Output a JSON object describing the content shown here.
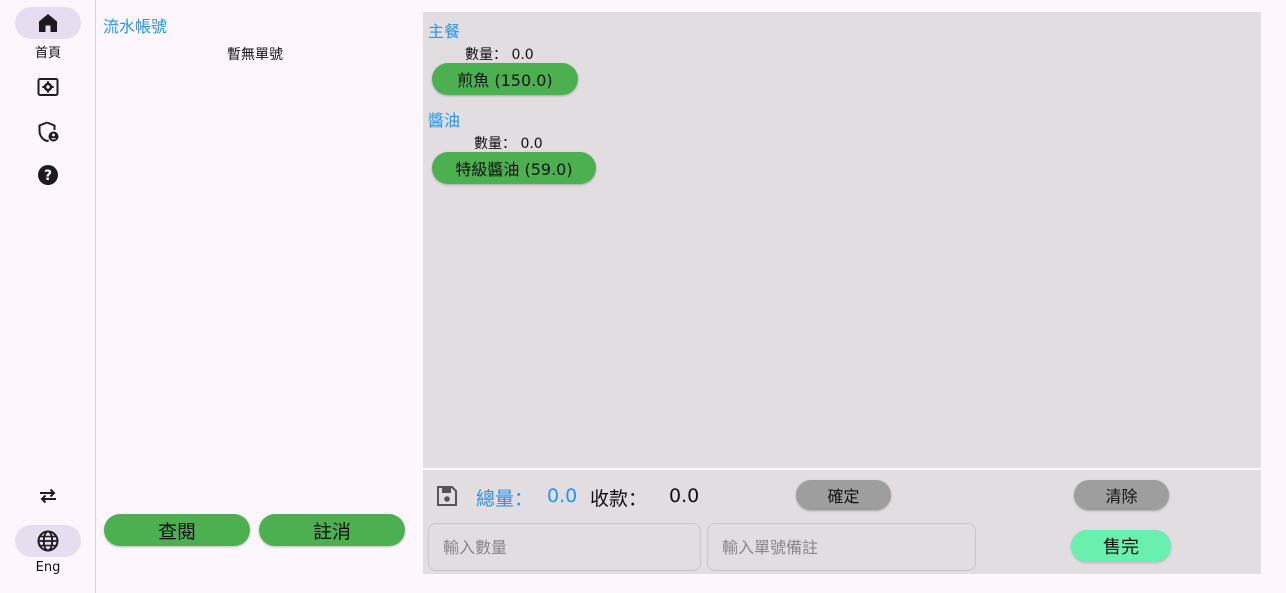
{
  "nav": {
    "home_label": "首頁",
    "lang_label": "Eng",
    "accent": "#e6def0"
  },
  "orders": {
    "title": "流水帳號",
    "empty_text": "暫無單號",
    "view_label": "查閱",
    "cancel_label": "註消"
  },
  "menu": {
    "categories": [
      {
        "title": "主餐",
        "qty_text": "數量： 0.0",
        "items": [
          {
            "label": "煎魚 (150.0)"
          }
        ]
      },
      {
        "title": "醬油",
        "qty_text": "數量： 0.0",
        "items": [
          {
            "label": "特級醬油 (59.0)"
          }
        ]
      }
    ]
  },
  "summary": {
    "total_label": "總量：",
    "total_value": "0.0",
    "pay_label": "收款：",
    "pay_value": "0.0",
    "confirm_label": "確定",
    "clear_label": "清除",
    "qty_placeholder": "輸入數量",
    "note_placeholder": "輸入單號備註",
    "soldout_label": "售完"
  },
  "colors": {
    "accent_blue": "#2196f3",
    "green_button": "#4caf50",
    "mint_button": "#69f0ae",
    "gray_button": "#9e9e9e",
    "panel_bg": "#e1dde1"
  },
  "icons": [
    "home-icon",
    "settings-icon",
    "admin-shield-icon",
    "help-icon",
    "swap-icon",
    "globe-icon",
    "save-icon"
  ]
}
